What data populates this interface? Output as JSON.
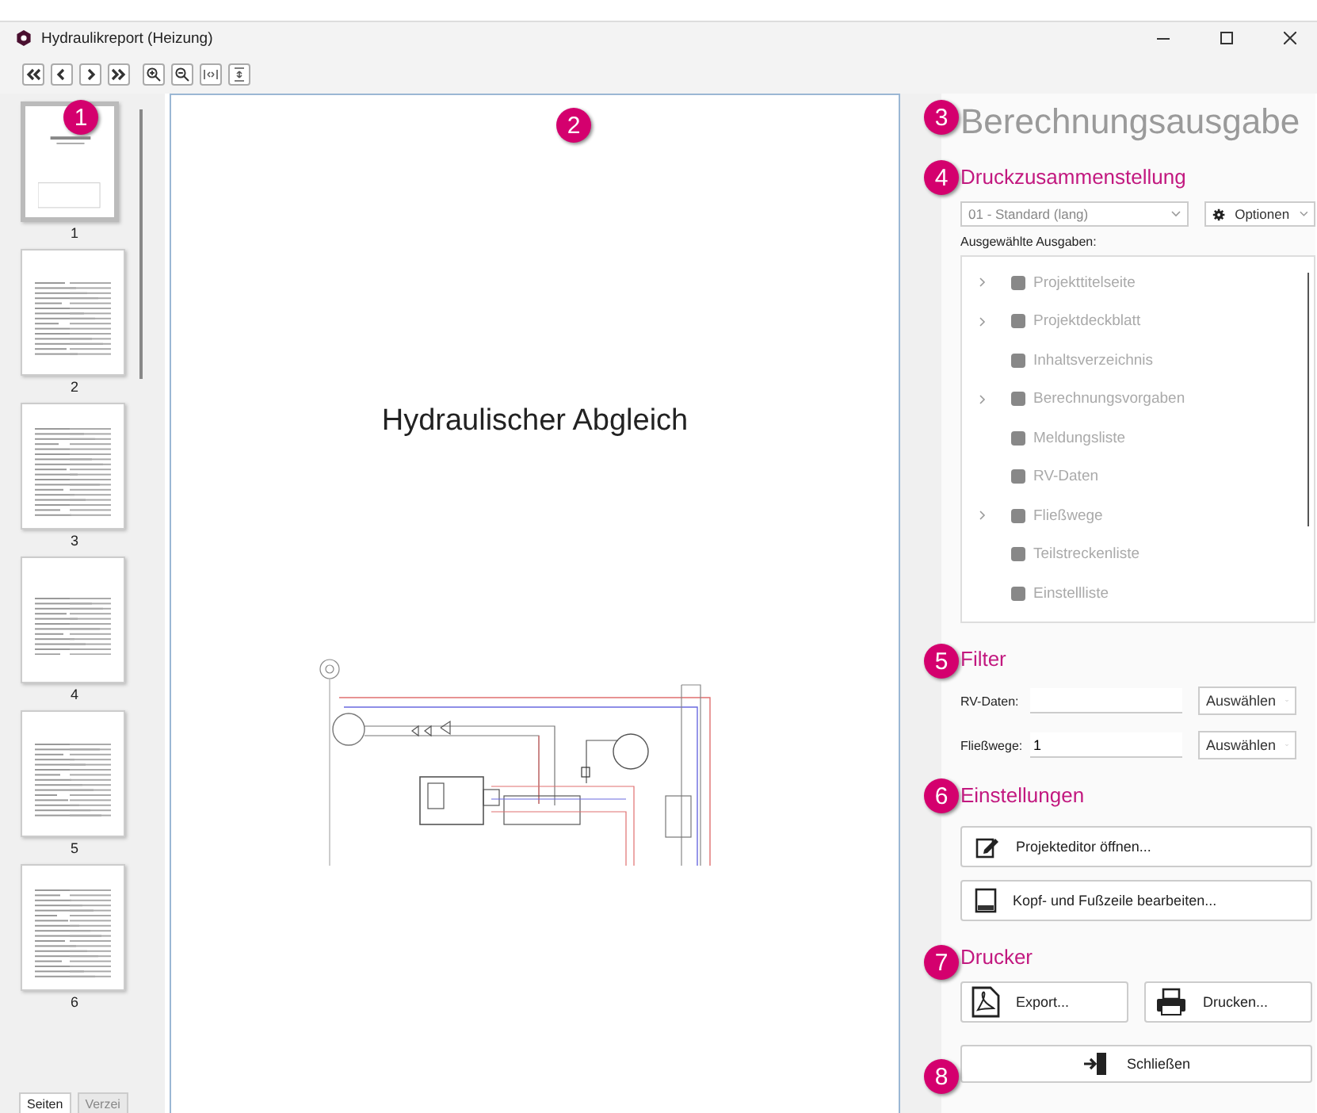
{
  "window": {
    "title": "Hydraulikreport (Heizung)"
  },
  "thumbnails": [
    {
      "page": "1",
      "selected": true
    },
    {
      "page": "2",
      "selected": false
    },
    {
      "page": "3",
      "selected": false
    },
    {
      "page": "4",
      "selected": false
    },
    {
      "page": "5",
      "selected": false
    },
    {
      "page": "6",
      "selected": false
    }
  ],
  "thumbnail_tabs": [
    {
      "label": "Seiten",
      "selected": true
    },
    {
      "label": "Verzei",
      "selected": false
    }
  ],
  "preview": {
    "title": "Hydraulischer Abgleich"
  },
  "panel": {
    "title": "Berechnungsausgabe",
    "print_section": {
      "heading": "Druckzusammenstellung",
      "preset": "01 - Standard (lang)",
      "options_button": "Optionen",
      "list_label": "Ausgewählte Ausgaben:",
      "items": [
        {
          "label": "Projekttitelseite",
          "expandable": true,
          "checked": true,
          "disabled": true
        },
        {
          "label": "Projektdeckblatt",
          "expandable": true,
          "checked": true,
          "disabled": true
        },
        {
          "label": "Inhaltsverzeichnis",
          "expandable": false,
          "checked": true,
          "disabled": true
        },
        {
          "label": "Berechnungsvorgaben",
          "expandable": true,
          "checked": true,
          "disabled": true
        },
        {
          "label": "Meldungsliste",
          "expandable": false,
          "checked": true,
          "disabled": true
        },
        {
          "label": "RV-Daten",
          "expandable": false,
          "checked": true,
          "disabled": true
        },
        {
          "label": "Fließwege",
          "expandable": true,
          "checked": true,
          "disabled": true
        },
        {
          "label": "Teilstreckenliste",
          "expandable": false,
          "checked": true,
          "disabled": true
        },
        {
          "label": "Einstellliste",
          "expandable": false,
          "checked": true,
          "disabled": true
        }
      ]
    },
    "filter": {
      "heading": "Filter",
      "rows": [
        {
          "label": "RV-Daten:",
          "button": "Auswählen"
        },
        {
          "label": "Fließwege:",
          "value": "1",
          "button": "Auswählen"
        }
      ]
    },
    "settings": {
      "heading": "Einstellungen",
      "buttons": [
        {
          "kind": "editor",
          "label": "Projekteditor öffnen..."
        },
        {
          "kind": "header_footer",
          "label": "Kopf- und Fußzeile bearbeiten..."
        }
      ]
    },
    "printer": {
      "heading": "Drucker",
      "buttons": [
        {
          "kind": "pdf",
          "label": "Export..."
        },
        {
          "kind": "print",
          "label": "Drucken..."
        }
      ]
    },
    "close_button": {
      "label": "Schließen"
    }
  },
  "callouts": [
    "1",
    "2",
    "3",
    "4",
    "5",
    "6",
    "7",
    "8"
  ]
}
